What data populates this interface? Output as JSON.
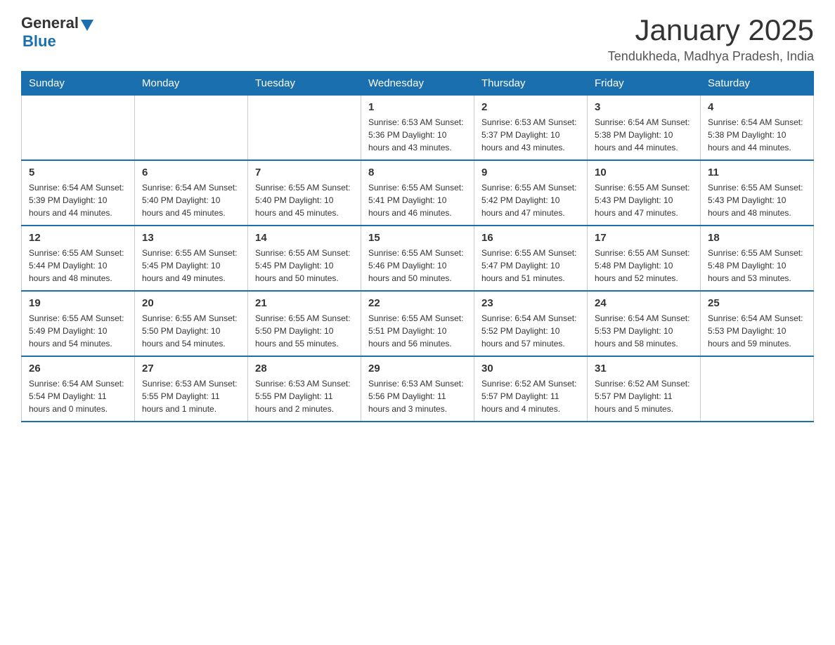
{
  "header": {
    "logo_general": "General",
    "logo_blue": "Blue",
    "month_title": "January 2025",
    "location": "Tendukheda, Madhya Pradesh, India"
  },
  "days_of_week": [
    "Sunday",
    "Monday",
    "Tuesday",
    "Wednesday",
    "Thursday",
    "Friday",
    "Saturday"
  ],
  "weeks": [
    {
      "days": [
        {
          "num": "",
          "info": ""
        },
        {
          "num": "",
          "info": ""
        },
        {
          "num": "",
          "info": ""
        },
        {
          "num": "1",
          "info": "Sunrise: 6:53 AM\nSunset: 5:36 PM\nDaylight: 10 hours and 43 minutes."
        },
        {
          "num": "2",
          "info": "Sunrise: 6:53 AM\nSunset: 5:37 PM\nDaylight: 10 hours and 43 minutes."
        },
        {
          "num": "3",
          "info": "Sunrise: 6:54 AM\nSunset: 5:38 PM\nDaylight: 10 hours and 44 minutes."
        },
        {
          "num": "4",
          "info": "Sunrise: 6:54 AM\nSunset: 5:38 PM\nDaylight: 10 hours and 44 minutes."
        }
      ]
    },
    {
      "days": [
        {
          "num": "5",
          "info": "Sunrise: 6:54 AM\nSunset: 5:39 PM\nDaylight: 10 hours and 44 minutes."
        },
        {
          "num": "6",
          "info": "Sunrise: 6:54 AM\nSunset: 5:40 PM\nDaylight: 10 hours and 45 minutes."
        },
        {
          "num": "7",
          "info": "Sunrise: 6:55 AM\nSunset: 5:40 PM\nDaylight: 10 hours and 45 minutes."
        },
        {
          "num": "8",
          "info": "Sunrise: 6:55 AM\nSunset: 5:41 PM\nDaylight: 10 hours and 46 minutes."
        },
        {
          "num": "9",
          "info": "Sunrise: 6:55 AM\nSunset: 5:42 PM\nDaylight: 10 hours and 47 minutes."
        },
        {
          "num": "10",
          "info": "Sunrise: 6:55 AM\nSunset: 5:43 PM\nDaylight: 10 hours and 47 minutes."
        },
        {
          "num": "11",
          "info": "Sunrise: 6:55 AM\nSunset: 5:43 PM\nDaylight: 10 hours and 48 minutes."
        }
      ]
    },
    {
      "days": [
        {
          "num": "12",
          "info": "Sunrise: 6:55 AM\nSunset: 5:44 PM\nDaylight: 10 hours and 48 minutes."
        },
        {
          "num": "13",
          "info": "Sunrise: 6:55 AM\nSunset: 5:45 PM\nDaylight: 10 hours and 49 minutes."
        },
        {
          "num": "14",
          "info": "Sunrise: 6:55 AM\nSunset: 5:45 PM\nDaylight: 10 hours and 50 minutes."
        },
        {
          "num": "15",
          "info": "Sunrise: 6:55 AM\nSunset: 5:46 PM\nDaylight: 10 hours and 50 minutes."
        },
        {
          "num": "16",
          "info": "Sunrise: 6:55 AM\nSunset: 5:47 PM\nDaylight: 10 hours and 51 minutes."
        },
        {
          "num": "17",
          "info": "Sunrise: 6:55 AM\nSunset: 5:48 PM\nDaylight: 10 hours and 52 minutes."
        },
        {
          "num": "18",
          "info": "Sunrise: 6:55 AM\nSunset: 5:48 PM\nDaylight: 10 hours and 53 minutes."
        }
      ]
    },
    {
      "days": [
        {
          "num": "19",
          "info": "Sunrise: 6:55 AM\nSunset: 5:49 PM\nDaylight: 10 hours and 54 minutes."
        },
        {
          "num": "20",
          "info": "Sunrise: 6:55 AM\nSunset: 5:50 PM\nDaylight: 10 hours and 54 minutes."
        },
        {
          "num": "21",
          "info": "Sunrise: 6:55 AM\nSunset: 5:50 PM\nDaylight: 10 hours and 55 minutes."
        },
        {
          "num": "22",
          "info": "Sunrise: 6:55 AM\nSunset: 5:51 PM\nDaylight: 10 hours and 56 minutes."
        },
        {
          "num": "23",
          "info": "Sunrise: 6:54 AM\nSunset: 5:52 PM\nDaylight: 10 hours and 57 minutes."
        },
        {
          "num": "24",
          "info": "Sunrise: 6:54 AM\nSunset: 5:53 PM\nDaylight: 10 hours and 58 minutes."
        },
        {
          "num": "25",
          "info": "Sunrise: 6:54 AM\nSunset: 5:53 PM\nDaylight: 10 hours and 59 minutes."
        }
      ]
    },
    {
      "days": [
        {
          "num": "26",
          "info": "Sunrise: 6:54 AM\nSunset: 5:54 PM\nDaylight: 11 hours and 0 minutes."
        },
        {
          "num": "27",
          "info": "Sunrise: 6:53 AM\nSunset: 5:55 PM\nDaylight: 11 hours and 1 minute."
        },
        {
          "num": "28",
          "info": "Sunrise: 6:53 AM\nSunset: 5:55 PM\nDaylight: 11 hours and 2 minutes."
        },
        {
          "num": "29",
          "info": "Sunrise: 6:53 AM\nSunset: 5:56 PM\nDaylight: 11 hours and 3 minutes."
        },
        {
          "num": "30",
          "info": "Sunrise: 6:52 AM\nSunset: 5:57 PM\nDaylight: 11 hours and 4 minutes."
        },
        {
          "num": "31",
          "info": "Sunrise: 6:52 AM\nSunset: 5:57 PM\nDaylight: 11 hours and 5 minutes."
        },
        {
          "num": "",
          "info": ""
        }
      ]
    }
  ]
}
